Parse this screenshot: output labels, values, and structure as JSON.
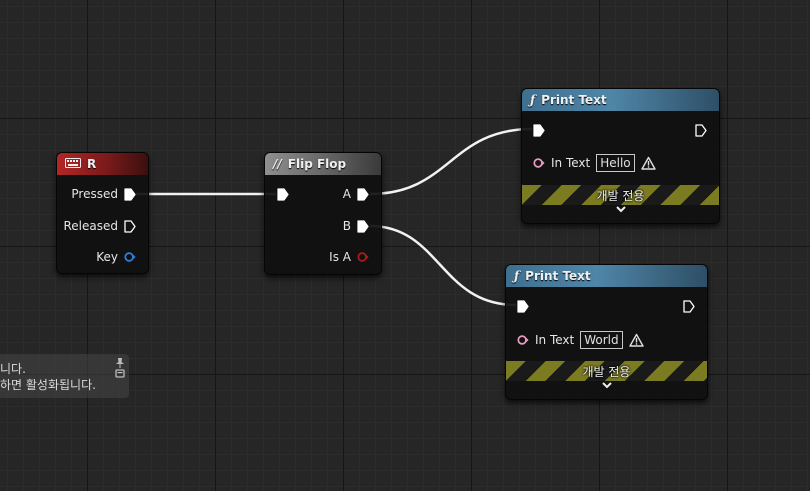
{
  "event_node": {
    "title": "R",
    "pins": {
      "pressed": "Pressed",
      "released": "Released",
      "key": "Key"
    }
  },
  "flipflop_node": {
    "title": "Flip Flop",
    "pins": {
      "a": "A",
      "b": "B",
      "is_a": "Is A"
    }
  },
  "print_nodes": [
    {
      "title": "Print Text",
      "in_text_label": "In Text",
      "in_text_value": "Hello",
      "dev_label": "개발 전용"
    },
    {
      "title": "Print Text",
      "in_text_label": "In Text",
      "in_text_value": "World",
      "dev_label": "개발 전용"
    }
  ],
  "tooltip": {
    "line1": "니다.",
    "line2": "하면 활성화됩니다."
  },
  "colors": {
    "event_header": "#b32626",
    "function_header": "#4f86a8",
    "macro_header": "#6f6f6f",
    "text_pin": "#e89ac0",
    "key_pin": "#2f7fe0",
    "bool_pin": "#a01818",
    "dev_stripe": "#7b7b22"
  }
}
